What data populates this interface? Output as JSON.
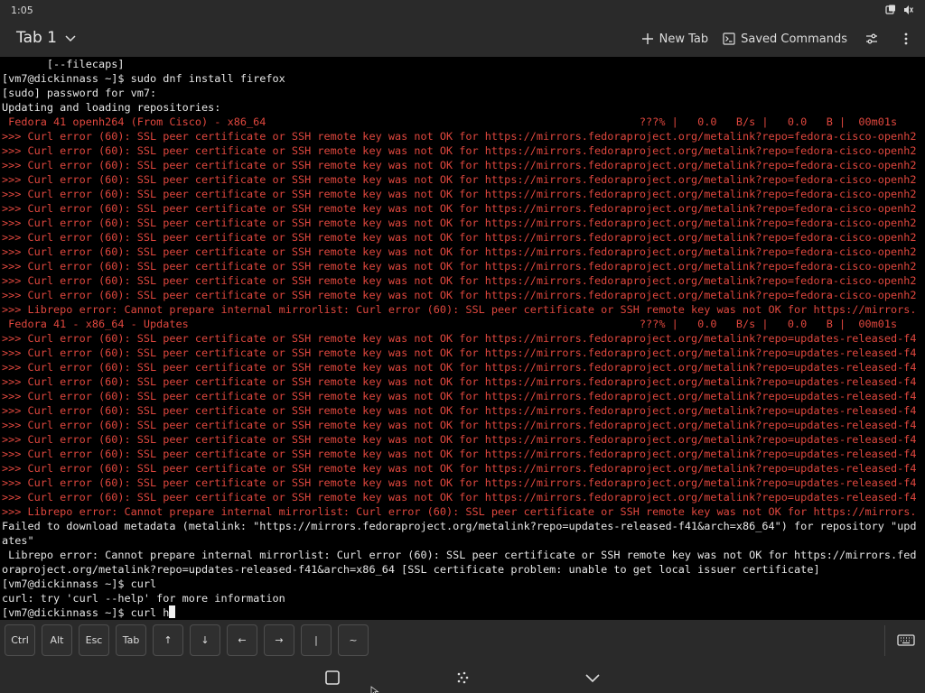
{
  "status_bar": {
    "time": "1:05",
    "icons": [
      "screen-rotation-icon",
      "volume-muted-icon"
    ]
  },
  "app_bar": {
    "tab_label": "Tab 1",
    "new_tab_label": "New Tab",
    "saved_commands_label": "Saved Commands",
    "icons": [
      "chevron-down-icon",
      "plus-icon",
      "terminal-icon",
      "sliders-icon",
      "more-vert-icon"
    ]
  },
  "terminal": {
    "lines": [
      {
        "text": "       [--filecaps]",
        "type": "normal"
      },
      {
        "text": "[vm7@dickinnass ~]$ sudo dnf install firefox",
        "type": "normal"
      },
      {
        "text": "[sudo] password for vm7:",
        "type": "normal"
      },
      {
        "text": "Updating and loading repositories:",
        "type": "normal"
      },
      {
        "text": " Fedora 41 openh264 (From Cisco) - x86_64                                                          ???% |   0.0   B/s |   0.0   B |  00m01s",
        "type": "repo"
      },
      {
        "text": ">>> Curl error (60): SSL peer certificate or SSH remote key was not OK for https://mirrors.fedoraproject.org/metalink?repo=fedora-cisco-openh2",
        "type": "err"
      },
      {
        "text": ">>> Curl error (60): SSL peer certificate or SSH remote key was not OK for https://mirrors.fedoraproject.org/metalink?repo=fedora-cisco-openh2",
        "type": "err"
      },
      {
        "text": ">>> Curl error (60): SSL peer certificate or SSH remote key was not OK for https://mirrors.fedoraproject.org/metalink?repo=fedora-cisco-openh2",
        "type": "err"
      },
      {
        "text": ">>> Curl error (60): SSL peer certificate or SSH remote key was not OK for https://mirrors.fedoraproject.org/metalink?repo=fedora-cisco-openh2",
        "type": "err"
      },
      {
        "text": ">>> Curl error (60): SSL peer certificate or SSH remote key was not OK for https://mirrors.fedoraproject.org/metalink?repo=fedora-cisco-openh2",
        "type": "err"
      },
      {
        "text": ">>> Curl error (60): SSL peer certificate or SSH remote key was not OK for https://mirrors.fedoraproject.org/metalink?repo=fedora-cisco-openh2",
        "type": "err"
      },
      {
        "text": ">>> Curl error (60): SSL peer certificate or SSH remote key was not OK for https://mirrors.fedoraproject.org/metalink?repo=fedora-cisco-openh2",
        "type": "err"
      },
      {
        "text": ">>> Curl error (60): SSL peer certificate or SSH remote key was not OK for https://mirrors.fedoraproject.org/metalink?repo=fedora-cisco-openh2",
        "type": "err"
      },
      {
        "text": ">>> Curl error (60): SSL peer certificate or SSH remote key was not OK for https://mirrors.fedoraproject.org/metalink?repo=fedora-cisco-openh2",
        "type": "err"
      },
      {
        "text": ">>> Curl error (60): SSL peer certificate or SSH remote key was not OK for https://mirrors.fedoraproject.org/metalink?repo=fedora-cisco-openh2",
        "type": "err"
      },
      {
        "text": ">>> Curl error (60): SSL peer certificate or SSH remote key was not OK for https://mirrors.fedoraproject.org/metalink?repo=fedora-cisco-openh2",
        "type": "err"
      },
      {
        "text": ">>> Curl error (60): SSL peer certificate or SSH remote key was not OK for https://mirrors.fedoraproject.org/metalink?repo=fedora-cisco-openh2",
        "type": "err"
      },
      {
        "text": ">>> Librepo error: Cannot prepare internal mirrorlist: Curl error (60): SSL peer certificate or SSH remote key was not OK for https://mirrors.",
        "type": "err"
      },
      {
        "text": " Fedora 41 - x86_64 - Updates                                                                      ???% |   0.0   B/s |   0.0   B |  00m01s",
        "type": "repo"
      },
      {
        "text": ">>> Curl error (60): SSL peer certificate or SSH remote key was not OK for https://mirrors.fedoraproject.org/metalink?repo=updates-released-f4",
        "type": "err"
      },
      {
        "text": ">>> Curl error (60): SSL peer certificate or SSH remote key was not OK for https://mirrors.fedoraproject.org/metalink?repo=updates-released-f4",
        "type": "err"
      },
      {
        "text": ">>> Curl error (60): SSL peer certificate or SSH remote key was not OK for https://mirrors.fedoraproject.org/metalink?repo=updates-released-f4",
        "type": "err"
      },
      {
        "text": ">>> Curl error (60): SSL peer certificate or SSH remote key was not OK for https://mirrors.fedoraproject.org/metalink?repo=updates-released-f4",
        "type": "err"
      },
      {
        "text": ">>> Curl error (60): SSL peer certificate or SSH remote key was not OK for https://mirrors.fedoraproject.org/metalink?repo=updates-released-f4",
        "type": "err"
      },
      {
        "text": ">>> Curl error (60): SSL peer certificate or SSH remote key was not OK for https://mirrors.fedoraproject.org/metalink?repo=updates-released-f4",
        "type": "err"
      },
      {
        "text": ">>> Curl error (60): SSL peer certificate or SSH remote key was not OK for https://mirrors.fedoraproject.org/metalink?repo=updates-released-f4",
        "type": "err"
      },
      {
        "text": ">>> Curl error (60): SSL peer certificate or SSH remote key was not OK for https://mirrors.fedoraproject.org/metalink?repo=updates-released-f4",
        "type": "err"
      },
      {
        "text": ">>> Curl error (60): SSL peer certificate or SSH remote key was not OK for https://mirrors.fedoraproject.org/metalink?repo=updates-released-f4",
        "type": "err"
      },
      {
        "text": ">>> Curl error (60): SSL peer certificate or SSH remote key was not OK for https://mirrors.fedoraproject.org/metalink?repo=updates-released-f4",
        "type": "err"
      },
      {
        "text": ">>> Curl error (60): SSL peer certificate or SSH remote key was not OK for https://mirrors.fedoraproject.org/metalink?repo=updates-released-f4",
        "type": "err"
      },
      {
        "text": ">>> Curl error (60): SSL peer certificate or SSH remote key was not OK for https://mirrors.fedoraproject.org/metalink?repo=updates-released-f4",
        "type": "err"
      },
      {
        "text": ">>> Librepo error: Cannot prepare internal mirrorlist: Curl error (60): SSL peer certificate or SSH remote key was not OK for https://mirrors.",
        "type": "err"
      },
      {
        "text": "Failed to download metadata (metalink: \"https://mirrors.fedoraproject.org/metalink?repo=updates-released-f41&arch=x86_64\") for repository \"upd",
        "type": "normal"
      },
      {
        "text": "ates\"",
        "type": "normal"
      },
      {
        "text": " Librepo error: Cannot prepare internal mirrorlist: Curl error (60): SSL peer certificate or SSH remote key was not OK for https://mirrors.fed",
        "type": "normal"
      },
      {
        "text": "oraproject.org/metalink?repo=updates-released-f41&arch=x86_64 [SSL certificate problem: unable to get local issuer certificate]",
        "type": "normal"
      },
      {
        "text": "[vm7@dickinnass ~]$ curl",
        "type": "normal"
      },
      {
        "text": "curl: try 'curl --help' for more information",
        "type": "normal"
      },
      {
        "text": "[vm7@dickinnass ~]$ curl h",
        "type": "prompt"
      }
    ]
  },
  "keybar": {
    "keys": [
      "Ctrl",
      "Alt",
      "Esc",
      "Tab",
      "↑",
      "↓",
      "←",
      "→",
      "|",
      "~"
    ],
    "key_names": [
      "ctrl",
      "alt",
      "esc",
      "tab",
      "arrow-up",
      "arrow-down",
      "arrow-left",
      "arrow-right",
      "pipe",
      "tilde"
    ]
  },
  "colors": {
    "bar_background": "#2a2a2a",
    "terminal_background": "#000000",
    "terminal_text": "#e6e6e6",
    "error_text": "#e0473e"
  }
}
